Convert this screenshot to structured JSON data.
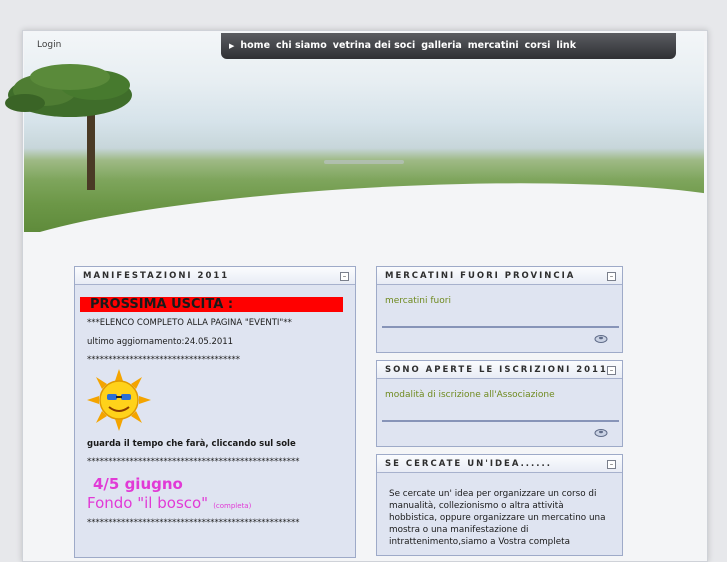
{
  "login": "Login",
  "nav": [
    "home",
    "chi siamo",
    "vetrina dei soci",
    "galleria",
    "mercatini",
    "corsi",
    "link"
  ],
  "left_panel": {
    "title": "MANIFESTAZIONI 2011",
    "banner": "PROSSIMA USCITA :",
    "line1": "***ELENCO COMPLETO ALLA PAGINA \"EVENTI\"**",
    "line2": "ultimo aggiornamento:24.05.2011",
    "stars1": "************************************",
    "weather_text": "guarda il tempo che farà,  cliccando sul sole",
    "stars2": "**************************************************",
    "date_big": "4/5 giugno",
    "event_name": "Fondo \"il bosco\"",
    "event_note": "(completa)",
    "stars3": "**************************************************"
  },
  "panel1": {
    "title": "MERCATINI FUORI PROVINCIA",
    "link": "mercatini fuori"
  },
  "panel2": {
    "title": "SONO APERTE LE ISCRIZIONI 2011",
    "link": "modalità di iscrizione all'Associazione"
  },
  "panel3": {
    "title": "SE CERCATE UN'IDEA......",
    "text": "Se cercate un' idea per organizzare un corso di manualità, collezionismo o altra attività hobbistica, oppure organizzare un mercatino una mostra o una manifestazione di intrattenimento,siamo a Vostra completa"
  },
  "colors": {
    "accent_green": "#6f8a1f",
    "event_pink": "#e13ad6",
    "banner_red": "#ff0000"
  }
}
